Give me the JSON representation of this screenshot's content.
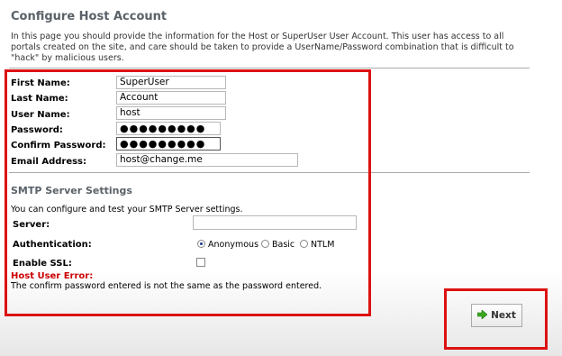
{
  "page": {
    "title": "Configure Host Account",
    "intro": "In this page you should provide the information for the Host or SuperUser User Account. This user has access to all portals created on the site, and care should be taken to provide a UserName/Password combination that is difficult to \"hack\" by malicious users."
  },
  "account": {
    "first_name_label": "First Name:",
    "first_name_value": "SuperUser",
    "last_name_label": "Last Name:",
    "last_name_value": "Account",
    "user_name_label": "User Name:",
    "user_name_value": "host",
    "password_label": "Password:",
    "password_value": "●●●●●●●●●",
    "confirm_password_label": "Confirm Password:",
    "confirm_password_value": "●●●●●●●●●",
    "email_label": "Email Address:",
    "email_value": "host@change.me"
  },
  "smtp": {
    "title": "SMTP Server Settings",
    "description": "You can configure and test your SMTP Server settings.",
    "server_label": "Server:",
    "server_value": "",
    "auth_label": "Authentication:",
    "auth_options": [
      "Anonymous",
      "Basic",
      "NTLM"
    ],
    "auth_selected": "Anonymous",
    "ssl_label": "Enable SSL:"
  },
  "error": {
    "title": "Host User Error:",
    "message": "The confirm password entered is not the same as the password entered."
  },
  "actions": {
    "next_label": "Next"
  },
  "colors": {
    "highlight": "#dd1111",
    "error": "#cc0000",
    "section_title": "#5a6168"
  }
}
